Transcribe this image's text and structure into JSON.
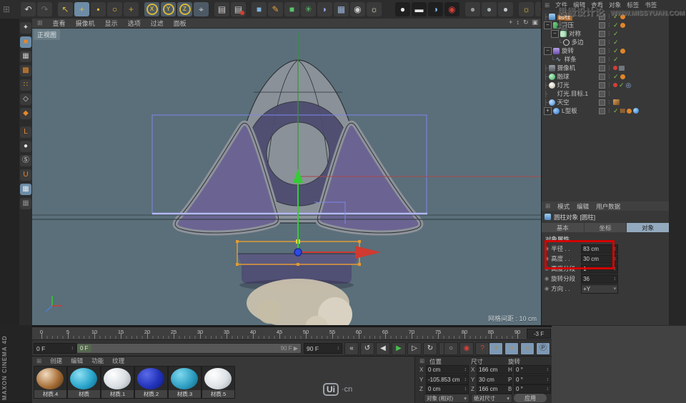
{
  "colors": {
    "viewport_bg": "#5a6f7a",
    "accent_orange": "#e29a34",
    "axis_red": "#d03a30",
    "axis_green": "#35cc35",
    "gizmo_blue": "#2d49e8",
    "selection_blue": "#7d84ea",
    "annotation_red": "#d20000",
    "active_tool_bg": "#6d8ca6",
    "tab_active": "#93a9bd"
  },
  "top_toolbar": {
    "items": [
      {
        "n": "main-menu-icon",
        "g": "⊞",
        "f": "#6a6a6a",
        "b": "none",
        "cls": "small",
        "ml": 2
      },
      {
        "n": "undo-button",
        "g": "↶",
        "f": "#d8d8d8",
        "ml": 12
      },
      {
        "n": "redo-button",
        "g": "↷",
        "f": "#6a6a6a"
      },
      {
        "sep": true
      },
      {
        "n": "live-selection-tool",
        "g": "↖",
        "f": "#e3b83a",
        "b": "#3f3f3f"
      },
      {
        "n": "move-tool",
        "g": "+",
        "f": "#e3b83a",
        "b": "#6d8ca6"
      },
      {
        "n": "scale-tool",
        "g": "▪",
        "f": "#e3b83a"
      },
      {
        "n": "rotate-tool",
        "g": "○",
        "f": "#e3b83a"
      },
      {
        "n": "last-used-tool",
        "g": "+",
        "f": "#c8a43a"
      },
      {
        "sep": true
      },
      {
        "n": "lock-x-axis-button",
        "g": "X",
        "b": "#4d5a66",
        "cls": "ring"
      },
      {
        "n": "lock-y-axis-button",
        "g": "Y",
        "b": "#4d5a66",
        "cls": "ring"
      },
      {
        "n": "lock-z-axis-button",
        "g": "Z",
        "b": "#4d5a66",
        "cls": "ring"
      },
      {
        "n": "coordinate-system-button",
        "g": "⌖",
        "f": "#cfcfcf",
        "b": "#4d5a66"
      },
      {
        "sep": true
      },
      {
        "n": "render-view-button",
        "g": "▤",
        "f": "#cfcfcf"
      },
      {
        "n": "render-settings-button",
        "g": "▤",
        "f": "#cfcfcf",
        "dot": true
      },
      {
        "sep": true
      },
      {
        "n": "add-primitive-cube-button",
        "g": "■",
        "f": "#7fb2dd"
      },
      {
        "n": "add-spline-button",
        "g": "✎",
        "f": "#e8a03a"
      },
      {
        "n": "add-generator-button",
        "g": "■",
        "f": "#59c26a"
      },
      {
        "n": "add-deformer-button",
        "g": "✳",
        "f": "#59c26a"
      },
      {
        "n": "add-environment-button",
        "g": "◗",
        "f": "#9aa5e8"
      },
      {
        "n": "add-array-button",
        "g": "▦",
        "f": "#9ab4d8"
      },
      {
        "n": "add-camera-button",
        "g": "◉",
        "f": "#cfcfcf"
      },
      {
        "n": "add-light-button",
        "g": "☼",
        "f": "#e8e3c8"
      }
    ],
    "right_items": [
      {
        "n": "display-gouraud-button",
        "g": "●",
        "f": "#e8e8e8",
        "b": "#1f1f1f"
      },
      {
        "n": "display-capsule-button",
        "g": "▬",
        "f": "#e8e8e8",
        "b": "#1f1f1f"
      },
      {
        "n": "display-half-button",
        "g": "◑",
        "f": "#7fb2dd",
        "b": "#1f1f1f"
      },
      {
        "n": "display-record-button",
        "g": "◉",
        "f": "#d04038",
        "b": "#1f1f1f"
      },
      {
        "sep": true
      },
      {
        "n": "shading-sphere-1",
        "g": "●",
        "f": "#9a9a9a"
      },
      {
        "n": "shading-sphere-2",
        "g": "●",
        "f": "#a8b0b4"
      },
      {
        "n": "shading-sphere-3",
        "g": "●",
        "f": "#c0c6ca"
      },
      {
        "sep": true
      },
      {
        "n": "sun-coordinates-button",
        "g": "☼",
        "f": "#e8c23a"
      },
      {
        "n": "axis-swap-button",
        "g": "+",
        "f": "#e8872a"
      },
      {
        "n": "view-navigation-button",
        "g": "↓",
        "f": "#e04030",
        "b": "#43566b"
      }
    ]
  },
  "left_palette": {
    "items": [
      {
        "n": "make-editable-button",
        "g": "✦",
        "f": "#cfcfcf"
      },
      {
        "n": "model-mode-button",
        "g": "■",
        "f": "#e8872a",
        "active": true
      },
      {
        "n": "texture-mode-button",
        "g": "▦",
        "f": "#c8c8c8"
      },
      {
        "n": "workplane-mode-button",
        "g": "▩",
        "f": "#e8872a"
      },
      {
        "n": "points-mode-button",
        "g": "∷",
        "f": "#e8b03a"
      },
      {
        "n": "edges-mode-button",
        "g": "◇",
        "f": "#d8d8d8"
      },
      {
        "n": "polygons-mode-button",
        "g": "◆",
        "f": "#e8872a"
      },
      {
        "sep": true
      },
      {
        "n": "enable-axis-button",
        "g": "L",
        "f": "#e8872a"
      },
      {
        "n": "viewport-interaction-button",
        "g": "●",
        "f": "#e8e8e8"
      },
      {
        "n": "enable-quantizing-button",
        "g": "Ⓢ",
        "f": "#d8d8d8"
      },
      {
        "n": "enable-snap-button",
        "g": "U",
        "f": "#e8872a"
      },
      {
        "n": "workplane-lock-button",
        "g": "▦",
        "f": "#dfe8f0",
        "active": true
      },
      {
        "n": "workplane-snap-button",
        "g": "▦",
        "f": "#888"
      }
    ]
  },
  "viewport": {
    "menu": [
      "查看",
      "摄像机",
      "显示",
      "选项",
      "过滤",
      "面板"
    ],
    "corner_icons": [
      {
        "n": "pan-view-icon",
        "g": "+"
      },
      {
        "n": "zoom-view-icon",
        "g": "↕"
      },
      {
        "n": "rotate-view-icon",
        "g": "↻"
      },
      {
        "n": "toggle-view-icon",
        "g": "▣"
      }
    ],
    "view_label": "正视图",
    "grid_spacing": "网格间距 : 10 cm"
  },
  "object_manager": {
    "menu": [
      "文件",
      "编辑",
      "查看",
      "对象",
      "标签",
      "书签"
    ],
    "rows": [
      {
        "label": "圆柱",
        "icon": "cylinder",
        "indent": 0,
        "conn": "├",
        "selected": true,
        "marks": [
          "check"
        ],
        "tags": [
          "phong"
        ]
      },
      {
        "label": "挤压",
        "icon": "extrude",
        "indent": 0,
        "exp": "−",
        "marks": [
          "check"
        ],
        "tags": [
          "phong"
        ]
      },
      {
        "label": "对称",
        "icon": "symmetry",
        "indent": 1,
        "exp": "−",
        "marks": [
          "check"
        ],
        "tags": []
      },
      {
        "label": "多边",
        "icon": "nside",
        "indent": 2,
        "conn": "└",
        "marks": [
          "check"
        ],
        "tags": []
      },
      {
        "label": "旋转",
        "icon": "lathe",
        "indent": 0,
        "exp": "−",
        "marks": [
          "check"
        ],
        "tags": [
          "phong"
        ]
      },
      {
        "label": "样条",
        "icon": "spline",
        "glyph": "∿",
        "indent": 1,
        "conn": "└",
        "marks": [
          "check"
        ],
        "tags": []
      },
      {
        "label": "摄像机",
        "icon": "camera",
        "indent": 0,
        "conn": "├",
        "marks": [
          "red"
        ],
        "tags": [
          "camera"
        ]
      },
      {
        "label": "融球",
        "icon": "metaball",
        "round": true,
        "indent": 0,
        "conn": "├",
        "marks": [
          "check"
        ],
        "tags": [
          "phong"
        ]
      },
      {
        "label": "灯光",
        "icon": "light",
        "round": true,
        "indent": 0,
        "conn": "├",
        "marks": [
          "red",
          "check"
        ],
        "tags": [
          "target"
        ]
      },
      {
        "label": "灯光.目标.1",
        "icon": "light-target",
        "round": true,
        "indent": 0,
        "conn": "├",
        "marks": [],
        "tags": []
      },
      {
        "label": "天空",
        "icon": "sky",
        "round": true,
        "indent": 0,
        "conn": "├",
        "marks": [],
        "tags": [
          "photo"
        ]
      },
      {
        "label": "L型板",
        "icon": "sphere-blue",
        "round": true,
        "indent": 0,
        "exp": "+",
        "marks": [
          "check"
        ],
        "tags": [
          "film",
          "phong",
          "ball"
        ]
      }
    ]
  },
  "watermark": {
    "cn": "思缘设计论坛",
    "url": "WWW.MISSYUAN.COM"
  },
  "attribute_manager": {
    "menu": [
      "模式",
      "编辑",
      "用户数据"
    ],
    "object_title": "圆柱对象 [圆柱]",
    "tabs": [
      {
        "label": "基本",
        "active": false
      },
      {
        "label": "坐标",
        "active": false
      },
      {
        "label": "对象",
        "active": true
      }
    ],
    "section": "对象属性",
    "fields": [
      {
        "label": "半径 . .",
        "value": "83 cm",
        "control": "stepper"
      },
      {
        "label": "高度 . .",
        "value": "30 cm",
        "control": "stepper"
      },
      {
        "label": "高度分段",
        "value": "1",
        "control": "stepper"
      },
      {
        "label": "旋转分段",
        "value": "36",
        "control": "stepper"
      },
      {
        "label": "方向 . .",
        "value": "+Y",
        "control": "dropdown"
      }
    ]
  },
  "timeline": {
    "ticks": [
      0,
      5,
      10,
      15,
      20,
      25,
      30,
      35,
      40,
      45,
      50,
      55,
      60,
      65,
      70,
      75,
      80,
      85,
      90
    ],
    "end_box": "-3 F",
    "current_frame": "0 F",
    "range_start": "0 F",
    "range_end": "90 F",
    "end_field": "90 F",
    "transport": [
      {
        "n": "go-to-start-button",
        "g": "«"
      },
      {
        "n": "play-backwards-button",
        "g": "↺"
      },
      {
        "n": "previous-frame-button",
        "g": "◀"
      },
      {
        "n": "play-forwards-button",
        "g": "▶",
        "f": "#46c24a"
      },
      {
        "n": "next-frame-button",
        "g": "▷"
      },
      {
        "n": "loop-button",
        "g": "↻"
      },
      {
        "n": "go-to-end-button",
        "g": "»"
      }
    ],
    "records": [
      {
        "n": "record-keyframe-button",
        "g": "○",
        "f": "#bbb"
      },
      {
        "n": "autokey-button",
        "g": "◉",
        "f": "#d84038"
      },
      {
        "n": "keyframe-help-button",
        "g": "?",
        "f": "#d84038"
      }
    ],
    "toggles": [
      {
        "n": "record-position-toggle",
        "g": "+",
        "f": "#b08a2a",
        "b": "#7d99b5"
      },
      {
        "n": "record-scale-toggle",
        "g": "▪",
        "f": "#d8872a",
        "b": "#7d99b5"
      },
      {
        "n": "record-rotation-toggle",
        "g": "○",
        "f": "#b08a2a",
        "b": "#7d99b5"
      },
      {
        "n": "record-parameter-toggle",
        "g": "Ⓟ",
        "f": "#2a2a2a",
        "b": "#7d99b5"
      },
      {
        "n": "record-pla-toggle",
        "g": "∷",
        "f": "#444",
        "b": "#7d99b5"
      },
      {
        "n": "timeline-film-button",
        "g": "▤",
        "f": "#cfe0ee",
        "b": "#55718a"
      }
    ]
  },
  "materials": {
    "menu": [
      "创建",
      "编辑",
      "功能",
      "纹理"
    ],
    "items": [
      {
        "label": "材质.4",
        "c1": "#f2dcc0",
        "c2": "#a86f38",
        "c3": "#4a2f12"
      },
      {
        "label": "材质",
        "c1": "#8fe0f2",
        "c2": "#2aa6cc",
        "c3": "#0d6080"
      },
      {
        "label": "材质.1",
        "c1": "#ffffff",
        "c2": "#d8dde2",
        "c3": "#9aa2ab"
      },
      {
        "label": "材质.2",
        "c1": "#5a6ae8",
        "c2": "#2233bb",
        "c3": "#0d1670"
      },
      {
        "label": "材质.3",
        "c1": "#7fd8ee",
        "c2": "#2f9fc2",
        "c3": "#0c5f7e"
      },
      {
        "label": "材质.5",
        "c1": "#ffffff",
        "c2": "#dde2e6",
        "c3": "#a0a8b0"
      }
    ]
  },
  "coordinates": {
    "headers": [
      "位置",
      "尺寸",
      "旋转"
    ],
    "rows": [
      {
        "p_label": "X",
        "p": "0 cm",
        "s_label": "X",
        "s": "166 cm",
        "r_label": "H",
        "r": "0 °"
      },
      {
        "p_label": "Y",
        "p": "-105.853 cm",
        "s_label": "Y",
        "s": "30 cm",
        "r_label": "P",
        "r": "0 °"
      },
      {
        "p_label": "Z",
        "p": "0 cm",
        "s_label": "Z",
        "s": "166 cm",
        "r_label": "B",
        "r": "0 °"
      }
    ],
    "mode_position": "对象 (相对)",
    "mode_size": "绝对尺寸",
    "apply": "应用"
  },
  "branding": {
    "left_vertical": "MAXON  CINEMA 4D",
    "bottom_logo_box": "Ui",
    "bottom_logo_suffix": "·cn"
  }
}
